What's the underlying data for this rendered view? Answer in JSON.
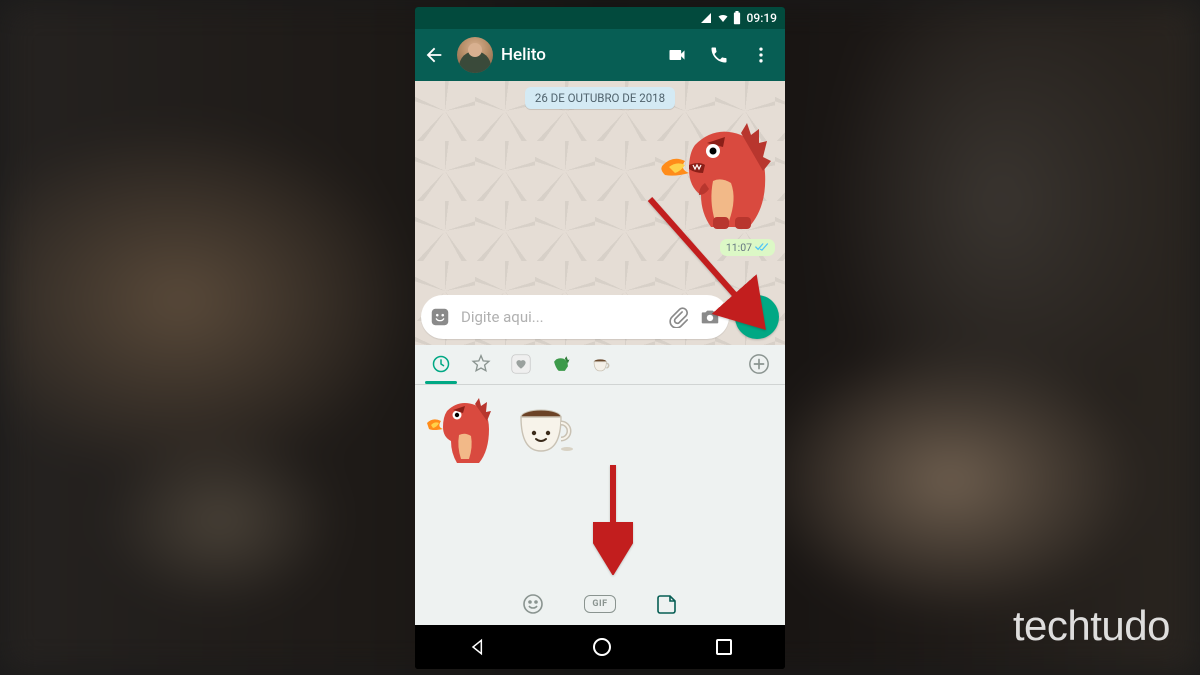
{
  "status_bar": {
    "time": "09:19"
  },
  "header": {
    "contact_name": "Helito"
  },
  "chat": {
    "date": "26 DE OUTUBRO DE 2018",
    "message_time": "11:07"
  },
  "input": {
    "placeholder": "Digite aqui..."
  },
  "panel_footer": {
    "gif_label": "GIF"
  },
  "watermark": "techtudo"
}
